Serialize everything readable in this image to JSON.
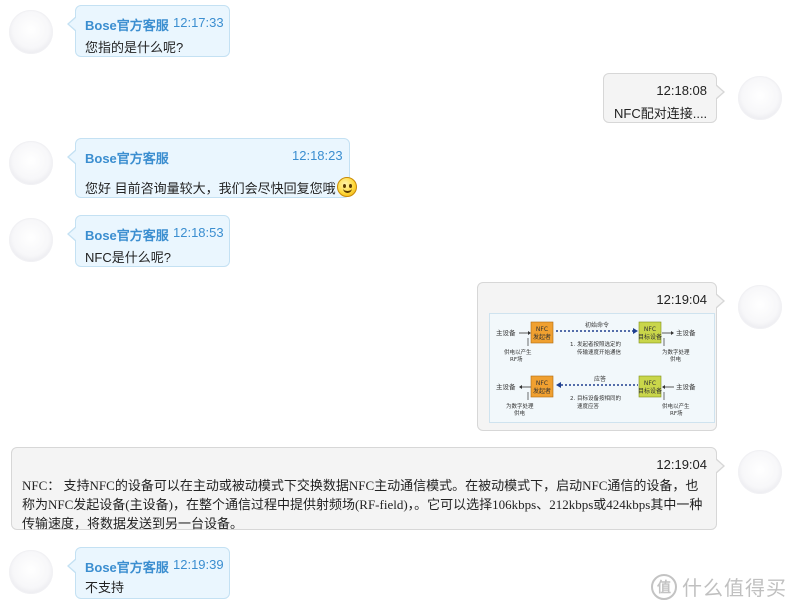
{
  "messages": [
    {
      "side": "left",
      "sender": "Bose官方客服",
      "time": "12:17:33",
      "text": "您指的是什么呢?"
    },
    {
      "side": "right",
      "time": "12:18:08",
      "text": "NFC配对连接...."
    },
    {
      "side": "left",
      "sender": "Bose官方客服",
      "time": "12:18:23",
      "text": "您好 目前咨询量较大，我们会尽快回复您哦",
      "emoji": "smiley-icon"
    },
    {
      "side": "left",
      "sender": "Bose官方客服",
      "time": "12:18:53",
      "text": "NFC是什么呢?"
    },
    {
      "side": "right",
      "time": "12:19:04",
      "image": "nfc-diagram"
    },
    {
      "side": "right",
      "time": "12:19:04",
      "text": "NFC： 支持NFC的设备可以在主动或被动模式下交换数据NFC主动通信模式。在被动模式下，启动NFC通信的设备，也称为NFC发起设备(主设备)，在整个通信过程中提供射频场(RF-field)，。它可以选择106kbps、212kbps或424kbps其中一种传输速度，将数据发送到另一台设备。"
    },
    {
      "side": "left",
      "sender": "Bose官方客服",
      "time": "12:19:39",
      "text": "不支持"
    }
  ],
  "diagram": {
    "host1": "主设备",
    "nfc_initiator": "NFC",
    "initiator_sub": "发起者",
    "cmd": "初始命令",
    "nfc_target": "NFC",
    "target_sub": "目标设备",
    "host2": "主设备",
    "power_rf": "供电以产生",
    "power_rf2": "RF场",
    "step1a": "1. 发起者按照选定的",
    "step1b": "传输速度开始通信",
    "power_digital": "为数字处理",
    "power_digital2": "供电",
    "host3": "主设备",
    "reply": "应答",
    "host4": "主设备",
    "power_digital_b": "为数字处理",
    "power_digital_b2": "供电",
    "step2a": "2. 目标设备按相同的",
    "step2b": "速度应答",
    "power_rf_b": "供电以产生",
    "power_rf_b2": "RF场"
  },
  "watermark": {
    "text": "什么值得买",
    "logo": "值"
  },
  "colors": {
    "accent": "#3b8ed0",
    "left_bubble": "#eaf6fe",
    "right_bubble": "#f4f4f4",
    "nfc_orange": "#f0a030",
    "nfc_green": "#c9d64a"
  }
}
